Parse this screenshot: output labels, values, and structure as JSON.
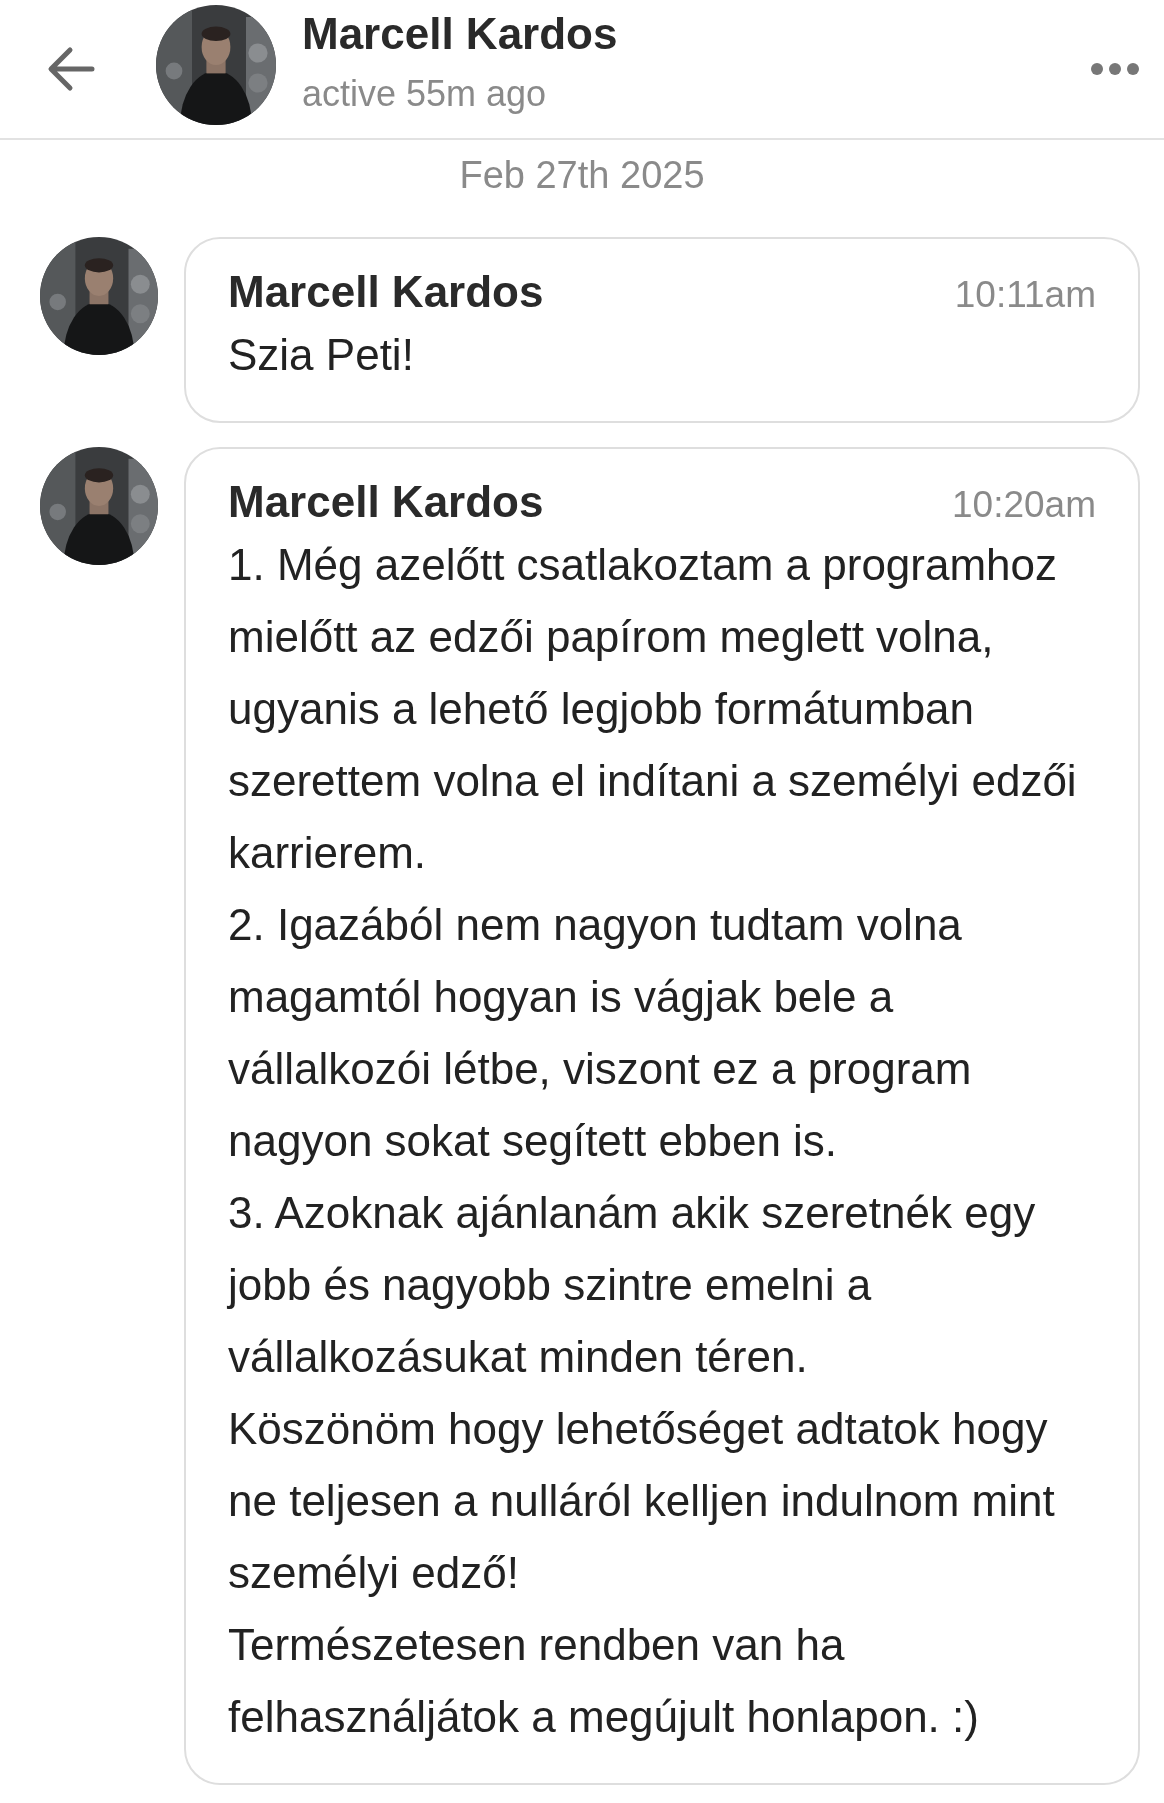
{
  "header": {
    "name": "Marcell Kardos",
    "status": "active 55m ago",
    "avatar": {
      "kind": "picture"
    }
  },
  "date_divider": "Feb 27th 2025",
  "messages": [
    {
      "sender": "Marcell Kardos",
      "time": "10:11am",
      "avatar": {
        "kind": "picture"
      },
      "paragraphs": [
        "Szia Peti!"
      ]
    },
    {
      "sender": "Marcell Kardos",
      "time": "10:20am",
      "avatar": {
        "kind": "picture"
      },
      "paragraphs": [
        "1. Még azelőtt csatlakoztam a programhoz mielőtt az edzői papírom meglett volna, ugyanis a lehető legjobb formátumban szerettem volna el indítani a személyi edzői karrierem.",
        "2. Igazából nem nagyon tudtam volna magamtól hogyan is vágjak bele a vállalkozói létbe, viszont ez a program nagyon sokat segített ebben is.",
        "3. Azoknak ajánlanám akik szeretnék egy jobb és nagyobb szintre emelni a vállalkozásukat minden téren.",
        "Köszönöm hogy lehetőséget adtatok hogy ne teljesen a nulláról kelljen indulnom mint személyi edző!",
        "Természetesen rendben van ha felhasználjátok a megújult honlapon. :)"
      ]
    }
  ]
}
